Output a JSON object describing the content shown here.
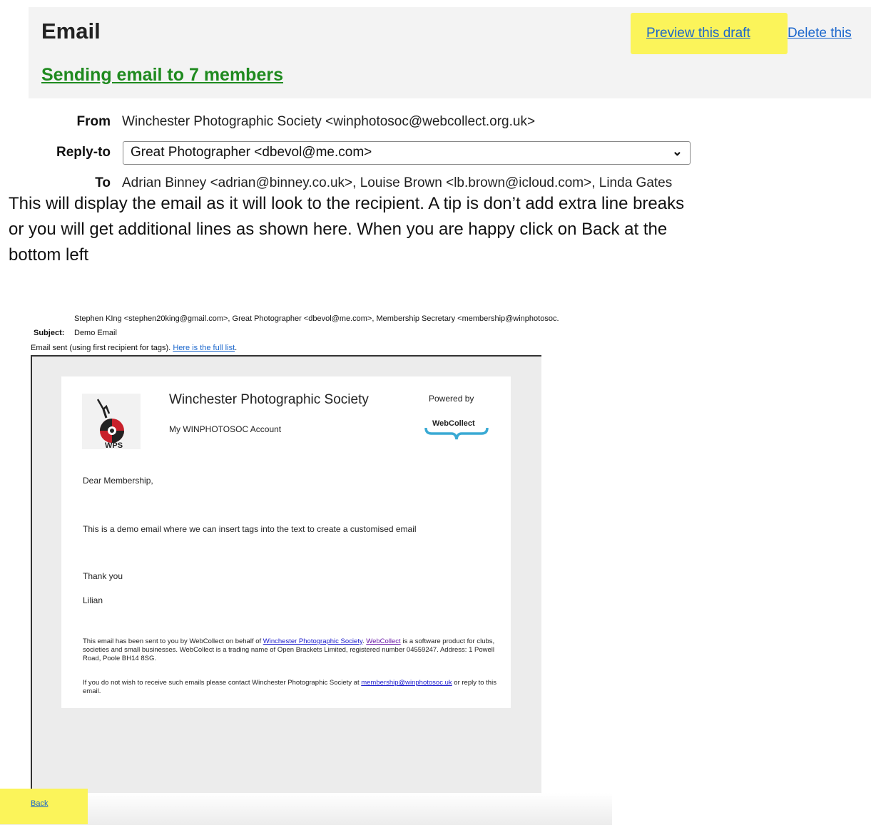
{
  "composer": {
    "title": "Email",
    "preview_link": "Preview this draft",
    "delete_link": "Delete this",
    "sending_heading": "Sending email to 7 members",
    "from_label": "From",
    "from_value": "Winchester Photographic Society <winphotosoc@webcollect.org.uk>",
    "replyto_label": "Reply-to",
    "replyto_value": "Great Photographer <dbevol@me.com>",
    "to_label": "To",
    "to_value": "Adrian Binney <adrian@binney.co.uk>, Louise Brown <lb.brown@icloud.com>, Linda Gates"
  },
  "instructions": {
    "line1": "This will display the email as it will look to the recipient. A tip is don’t add extra line breaks",
    "line2": "or you will get additional lines as shown here. When you are happy click on Back at the",
    "line3": "bottom left"
  },
  "preview": {
    "to_value": "Stephen KIng <stephen20king@gmail.com>, Great Photographer <dbevol@me.com>, Membership Secretary <membership@winphotosoc.",
    "subject_label": "Subject:",
    "subject_value": "Demo Email",
    "sent_text": "Email sent (using first recipient for tags).",
    "full_list_link": "Here is the full list",
    "sent_period": ".",
    "back_link": "Back"
  },
  "email": {
    "logo_text": "WPS",
    "org_name": "Winchester Photographic Society",
    "account": "My WINPHOTOSOC Account",
    "powered_by": "Powered by",
    "webcollect_logo": "WebCollect",
    "greeting": "Dear Membership,",
    "body": "This is a demo email  where we can insert tags into the text to create a customised email",
    "thanks": "Thank you",
    "signature": "Lilian",
    "footer1_a": "This email has been sent to you by WebCollect on behalf of ",
    "footer1_link1": "Winchester Photographic Society",
    "footer1_b": ". ",
    "footer1_link2": "WebCollect",
    "footer1_c": " is a software product for clubs, societies and small businesses. WebCollect is a trading name of Open Brackets Limited, registered number 04559247. Address: 1 Powell Road, Poole BH14 8SG.",
    "footer2_a": "If you do not wish to receive such emails please contact Winchester Photographic Society at ",
    "footer2_link": "membership@winphotosoc.uk",
    "footer2_b": " or reply to this email."
  },
  "colors": {
    "highlight": "#fbf45a",
    "link": "#1a66cc",
    "heading_green": "#1f8a1f",
    "logo_red": "#c8202a"
  }
}
